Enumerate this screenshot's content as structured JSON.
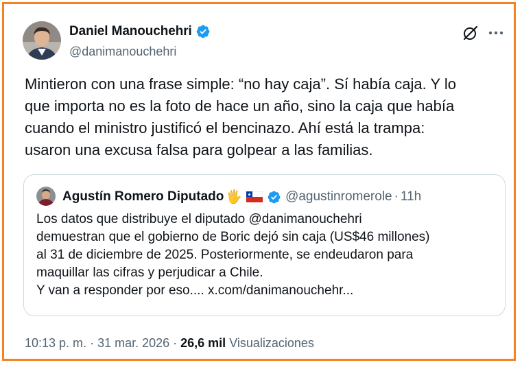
{
  "tweet": {
    "author_name": "Daniel Manouchehri",
    "author_handle": "@danimanouchehri",
    "text": "Mintieron con una frase simple: “no hay caja”. Sí había caja. Y lo\nque importa no es la foto de hace un año, sino la caja que había\ncuando el ministro justificó el bencinazo. Ahí está la trampa:\nusaron una excusa falsa para golpear a las familias.",
    "time": "10:13 p. m.",
    "date": "31 mar. 2026",
    "separator": "·",
    "views_count": "26,6 mil",
    "views_label": "Visualizaciones"
  },
  "quoted": {
    "author_name": "Agustín Romero Diputado",
    "hand_emoji": "🖐",
    "author_handle": "@agustinromerole",
    "dot": "·",
    "time": "11h",
    "text": "Los datos que distribuye el diputado @danimanouchehri\ndemuestran que el gobierno de Boric dejó sin caja (US$46 millones)\nal 31 de diciembre de 2025. Posteriormente, se endeudaron para\nmaquillar las cifras y perjudicar a Chile.\nY van a responder por eso.... x.com/danimanouchehr..."
  },
  "icons": {
    "verified": "verified-badge-icon",
    "grok": "grok-icon",
    "more": "more-icon",
    "flag": "chile-flag-icon"
  },
  "colors": {
    "border": "#f58220",
    "verified": "#1d9bf0",
    "secondary_text": "#536471"
  }
}
